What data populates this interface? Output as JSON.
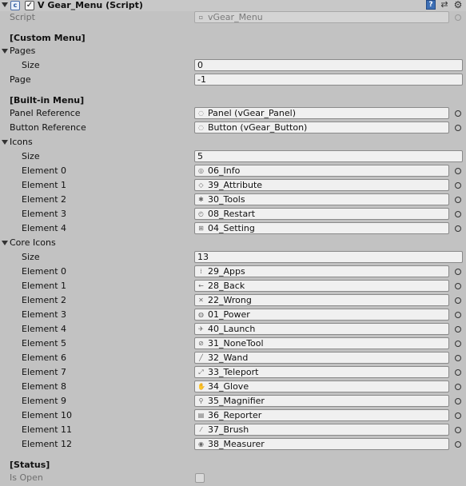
{
  "component": {
    "title": "V Gear_Menu (Script)",
    "script_label": "Script",
    "script_value": "vGear_Menu"
  },
  "custom_menu": {
    "header": "[Custom Menu]",
    "pages_label": "Pages",
    "size_label": "Size",
    "size_value": "0",
    "page_label": "Page",
    "page_value": "-1"
  },
  "builtin_menu": {
    "header": "[Built-in Menu]",
    "panel_label": "Panel Reference",
    "panel_value": "Panel (vGear_Panel)",
    "button_label": "Button Reference",
    "button_value": "Button (vGear_Button)"
  },
  "icons": {
    "label": "Icons",
    "size_label": "Size",
    "size_value": "5",
    "elements": [
      {
        "label": "Element 0",
        "value": "06_Info",
        "icon": "info-icon"
      },
      {
        "label": "Element 1",
        "value": "39_Attribute",
        "icon": "attribute-icon"
      },
      {
        "label": "Element 2",
        "value": "30_Tools",
        "icon": "tools-icon"
      },
      {
        "label": "Element 3",
        "value": "08_Restart",
        "icon": "restart-icon"
      },
      {
        "label": "Element 4",
        "value": "04_Setting",
        "icon": "setting-icon"
      }
    ]
  },
  "core_icons": {
    "label": "Core Icons",
    "size_label": "Size",
    "size_value": "13",
    "elements": [
      {
        "label": "Element 0",
        "value": "29_Apps",
        "icon": "apps-icon"
      },
      {
        "label": "Element 1",
        "value": "28_Back",
        "icon": "back-icon"
      },
      {
        "label": "Element 2",
        "value": "22_Wrong",
        "icon": "wrong-icon"
      },
      {
        "label": "Element 3",
        "value": "01_Power",
        "icon": "power-icon"
      },
      {
        "label": "Element 4",
        "value": "40_Launch",
        "icon": "launch-icon"
      },
      {
        "label": "Element 5",
        "value": "31_NoneTool",
        "icon": "nonetool-icon"
      },
      {
        "label": "Element 6",
        "value": "32_Wand",
        "icon": "wand-icon"
      },
      {
        "label": "Element 7",
        "value": "33_Teleport",
        "icon": "teleport-icon"
      },
      {
        "label": "Element 8",
        "value": "34_Glove",
        "icon": "glove-icon"
      },
      {
        "label": "Element 9",
        "value": "35_Magnifier",
        "icon": "magnifier-icon"
      },
      {
        "label": "Element 10",
        "value": "36_Reporter",
        "icon": "reporter-icon"
      },
      {
        "label": "Element 11",
        "value": "37_Brush",
        "icon": "brush-icon"
      },
      {
        "label": "Element 12",
        "value": "38_Measurer",
        "icon": "measurer-icon"
      }
    ]
  },
  "status": {
    "header": "[Status]",
    "is_open_label": "Is Open",
    "is_open_value": false
  }
}
